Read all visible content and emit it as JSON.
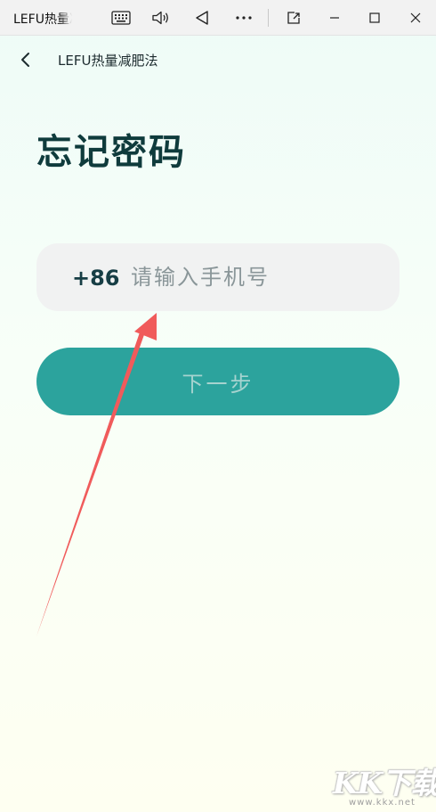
{
  "window": {
    "title": "LEFU热量减肥法",
    "controls": [
      {
        "name": "keyboard-icon"
      },
      {
        "name": "volume-icon"
      },
      {
        "name": "back-triangle-icon"
      },
      {
        "name": "more-icon"
      },
      {
        "name": "screen-capture-icon"
      },
      {
        "name": "minimize-icon"
      },
      {
        "name": "maximize-icon"
      },
      {
        "name": "close-icon"
      }
    ]
  },
  "header": {
    "back_icon": "chevron-left-icon",
    "title": "LEFU热量减肥法"
  },
  "page": {
    "title": "忘记密码"
  },
  "phone": {
    "country_code": "+86",
    "value": "",
    "placeholder": "请输入手机号"
  },
  "next_button": {
    "label": "下一步"
  },
  "watermark": {
    "logo": "KK下载",
    "url": "www.kkx.net"
  },
  "colors": {
    "accent": "#2ca39d",
    "title": "#0f3b3c",
    "annotation_arrow": "#f05b5b"
  }
}
